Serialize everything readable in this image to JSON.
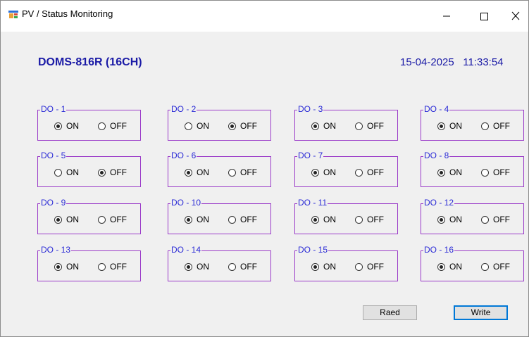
{
  "window": {
    "title": "PV / Status Monitoring",
    "controls": {
      "minimize": "—",
      "maximize": "☐",
      "close": "✕"
    }
  },
  "header": {
    "device_title": "DOMS-816R (16CH)",
    "date": "15-04-2025",
    "time": "11:33:54"
  },
  "option_labels": {
    "on": "ON",
    "off": "OFF"
  },
  "channels": [
    {
      "label": "DO - 1",
      "state": "ON"
    },
    {
      "label": "DO - 2",
      "state": "OFF"
    },
    {
      "label": "DO - 3",
      "state": "ON"
    },
    {
      "label": "DO - 4",
      "state": "ON"
    },
    {
      "label": "DO - 5",
      "state": "OFF"
    },
    {
      "label": "DO - 6",
      "state": "ON"
    },
    {
      "label": "DO - 7",
      "state": "ON"
    },
    {
      "label": "DO - 8",
      "state": "ON"
    },
    {
      "label": "DO - 9",
      "state": "ON"
    },
    {
      "label": "DO - 10",
      "state": "ON"
    },
    {
      "label": "DO - 11",
      "state": "ON"
    },
    {
      "label": "DO - 12",
      "state": "ON"
    },
    {
      "label": "DO - 13",
      "state": "ON"
    },
    {
      "label": "DO - 14",
      "state": "ON"
    },
    {
      "label": "DO - 15",
      "state": "ON"
    },
    {
      "label": "DO - 16",
      "state": "ON"
    }
  ],
  "buttons": {
    "read": "Raed",
    "write": "Write"
  },
  "colors": {
    "title_blue": "#1a1aa6",
    "group_border": "#9b3bc9",
    "group_label": "#2b2bd6",
    "write_focus": "#0078d7"
  }
}
